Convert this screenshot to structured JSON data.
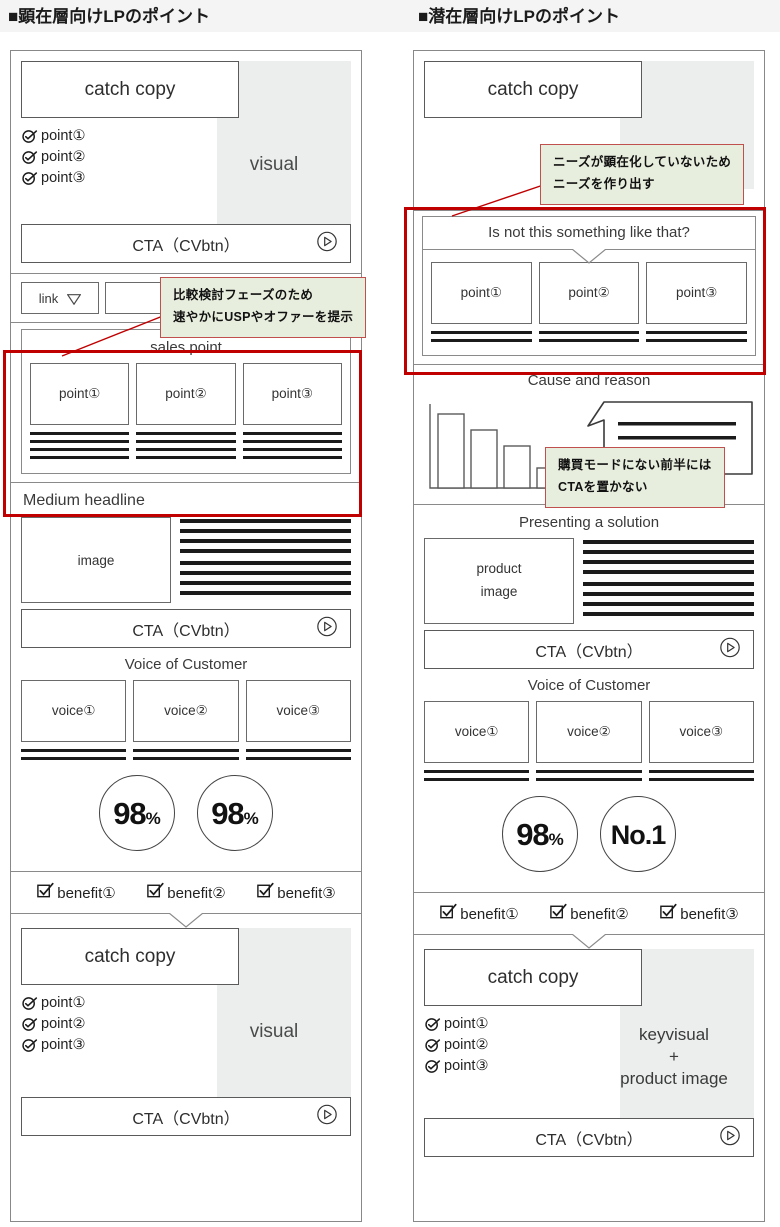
{
  "headers": {
    "left": "■顕在層向けLPのポイント",
    "right": "■潜在層向けLPのポイント"
  },
  "annotations": [
    {
      "id": "anno-1",
      "line1": "比較検討フェーズのため",
      "line2": "速やかにUSPやオファーを提示"
    },
    {
      "id": "anno-2",
      "line1": "ニーズが顕在化していないため",
      "line2": "ニーズを作り出す"
    },
    {
      "id": "anno-3",
      "line1": "購買モードにない前半には",
      "line2": "CTAを置かない"
    }
  ],
  "colors": {
    "highlight": "#c00000",
    "anno_fill": "#e8eede",
    "anno_border": "#c0504d",
    "visual_fill": "#eceeee",
    "wire_stroke": "#6a6a6a"
  },
  "left_column": {
    "hero": {
      "catch_copy": "catch copy",
      "visual_label": "visual",
      "points": [
        "point①",
        "point②",
        "point③"
      ],
      "cta": "CTA（CVbtn）"
    },
    "link_row": {
      "first_label": "link",
      "count": 4
    },
    "sales_point": {
      "title": "sales point",
      "cards": [
        "point①",
        "point②",
        "point③"
      ],
      "line_rows": 4
    },
    "medium_headline": {
      "title": "Medium headline",
      "image_label": "image",
      "line_rows": 8,
      "cta": "CTA（CVbtn）"
    },
    "voice": {
      "title": "Voice of Customer",
      "cards": [
        "voice①",
        "voice②",
        "voice③"
      ],
      "line_rows": 2
    },
    "badges": [
      {
        "value": "98",
        "unit": "%"
      },
      {
        "value": "98",
        "unit": "%"
      }
    ],
    "benefits": [
      "benefit①",
      "benefit②",
      "benefit③"
    ],
    "footer_hero": {
      "catch_copy": "catch copy",
      "visual_label": "visual",
      "points": [
        "point①",
        "point②",
        "point③"
      ],
      "cta": "CTA（CVbtn）"
    }
  },
  "right_column": {
    "hero": {
      "catch_copy": "catch copy",
      "cta": ""
    },
    "question": {
      "title": "Is not this something like that?",
      "cards": [
        "point①",
        "point②",
        "point③"
      ],
      "line_rows": 2
    },
    "cause": {
      "title": "Cause and reason",
      "bars": [
        72,
        58,
        42,
        20
      ],
      "bubble_lines": 2
    },
    "solution": {
      "title": "Presenting a solution",
      "image_label_1": "product",
      "image_label_2": "image",
      "line_rows": 8,
      "cta": "CTA（CVbtn）"
    },
    "voice": {
      "title": "Voice of Customer",
      "cards": [
        "voice①",
        "voice②",
        "voice③"
      ],
      "line_rows": 2
    },
    "badges": [
      {
        "value": "98",
        "unit": "%"
      },
      {
        "value": "No.1",
        "unit": ""
      }
    ],
    "benefits": [
      "benefit①",
      "benefit②",
      "benefit③"
    ],
    "footer_hero": {
      "catch_copy": "catch copy",
      "keyvisual_l1": "keyvisual",
      "keyvisual_l2": "+",
      "keyvisual_l3": "product image",
      "points": [
        "point①",
        "point②",
        "point③"
      ],
      "cta": "CTA（CVbtn）"
    }
  },
  "icons": {
    "check_circle": "check-circle-icon",
    "check_box": "check-box-icon",
    "play_circle": "play-circle-icon",
    "caret_down": "caret-down-icon"
  }
}
